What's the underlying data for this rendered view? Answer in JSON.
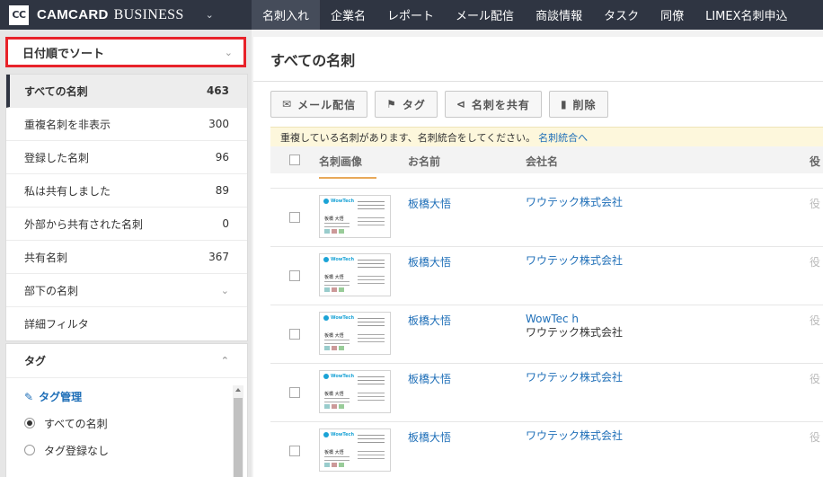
{
  "topbar": {
    "logo": "CC",
    "brand": "CAMCARD",
    "brand_sub": "BUSINESS",
    "nav": [
      "名刺入れ",
      "企業名",
      "レポート",
      "メール配信",
      "商談情報",
      "タスク",
      "同僚",
      "LIMEX名刺申込"
    ]
  },
  "sidebar": {
    "sort_label": "日付順でソート",
    "items": [
      {
        "label": "すべての名刺",
        "count": "463"
      },
      {
        "label": "重複名刺を非表示",
        "count": "300"
      },
      {
        "label": "登録した名刺",
        "count": "96"
      },
      {
        "label": "私は共有しました",
        "count": "89"
      },
      {
        "label": "外部から共有された名刺",
        "count": "0"
      },
      {
        "label": "共有名刺",
        "count": "367"
      },
      {
        "label": "部下の名刺",
        "count": ""
      },
      {
        "label": "詳細フィルタ",
        "count": ""
      }
    ],
    "tags": {
      "title": "タグ",
      "manage": "タグ管理",
      "options": [
        "すべての名刺",
        "タグ登録なし"
      ]
    }
  },
  "main": {
    "title": "すべての名刺",
    "toolbar": {
      "mail": "メール配信",
      "tag": "タグ",
      "share": "名刺を共有",
      "delete": "削除"
    },
    "notice": {
      "text": "重複している名刺があります、名刺統合をしてください。",
      "link": "名刺統合へ"
    },
    "columns": {
      "image": "名刺画像",
      "name": "お名前",
      "company": "会社名",
      "title": "役"
    },
    "rows": [
      {
        "name": "板橋大悟",
        "company_line1": "ワウテック株式会社",
        "company_line2": "",
        "title": "役"
      },
      {
        "name": "板橋大悟",
        "company_line1": "ワウテック株式会社",
        "company_line2": "",
        "title": "役"
      },
      {
        "name": "板橋大悟",
        "company_line1": "WowTec h",
        "company_line2": "ワウテック株式会社",
        "title": "役"
      },
      {
        "name": "板橋大悟",
        "company_line1": "ワウテック株式会社",
        "company_line2": "",
        "title": "役"
      },
      {
        "name": "板橋大悟",
        "company_line1": "ワウテック株式会社",
        "company_line2": "",
        "title": "役"
      }
    ],
    "card": {
      "logo": "WowTech",
      "person": "板橋 大悟"
    }
  }
}
